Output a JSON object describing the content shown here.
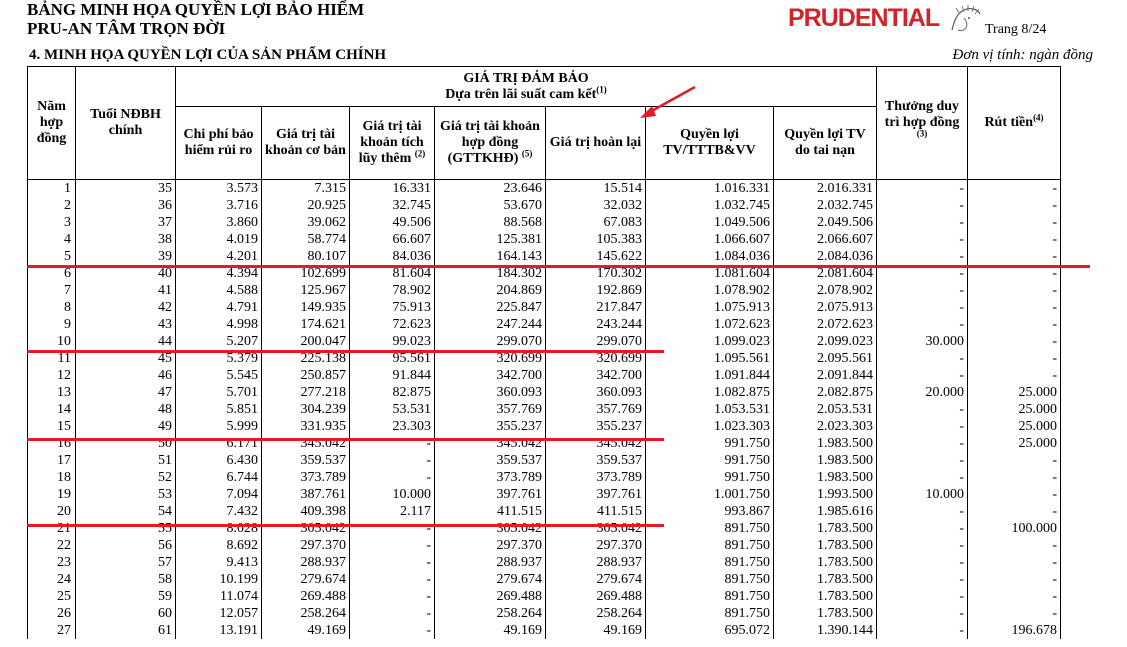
{
  "header": {
    "title_line1": "BẢNG MINH HỌA QUYỀN LỢI BẢO HIỂM",
    "title_line2": "PRU-AN TÂM TRỌN ĐỜI",
    "logo": "PRUDENTIAL",
    "page": "Trang 8/24",
    "section": "4. MINH HỌA QUYỀN LỢI CỦA SẢN PHẨM CHÍNH",
    "unit": "Đơn vị tính: ngàn đồng"
  },
  "table": {
    "guaranteed_title": "GIÁ TRỊ ĐẢM BẢO",
    "guaranteed_subtitle": "Dựa trên lãi suất cam kết",
    "guaranteed_subtitle_sup": "(1)",
    "col_year": "Năm hợp đồng",
    "col_age": "Tuổi NĐBH chính",
    "col_risk_cost": "Chi phí bảo hiểm rủi ro",
    "col_base_account": "Giá trị tài khoản cơ bản",
    "col_extra_account": "Giá trị tài khoản tích lũy thêm",
    "col_extra_account_sup": "(2)",
    "col_contract_account": "Giá trị tài khoản hợp đồng (GTTKHĐ)",
    "col_contract_account_sup": "(5)",
    "col_surrender": "Giá trị hoàn lại",
    "col_death_tpd": "Quyền lợi TV/TTTB&VV",
    "col_accident": "Quyền lợi TV do tai nạn",
    "col_bonus": "Thưởng duy trì hợp đồng",
    "col_bonus_sup": "(3)",
    "col_withdraw": "Rút tiền",
    "col_withdraw_sup": "(4)",
    "rows": [
      [
        "1",
        "35",
        "3.573",
        "7.315",
        "16.331",
        "23.646",
        "15.514",
        "1.016.331",
        "2.016.331",
        "-",
        "-"
      ],
      [
        "2",
        "36",
        "3.716",
        "20.925",
        "32.745",
        "53.670",
        "32.032",
        "1.032.745",
        "2.032.745",
        "-",
        "-"
      ],
      [
        "3",
        "37",
        "3.860",
        "39.062",
        "49.506",
        "88.568",
        "67.083",
        "1.049.506",
        "2.049.506",
        "-",
        "-"
      ],
      [
        "4",
        "38",
        "4.019",
        "58.774",
        "66.607",
        "125.381",
        "105.383",
        "1.066.607",
        "2.066.607",
        "-",
        "-"
      ],
      [
        "5",
        "39",
        "4.201",
        "80.107",
        "84.036",
        "164.143",
        "145.622",
        "1.084.036",
        "2.084.036",
        "-",
        "-"
      ],
      [
        "6",
        "40",
        "4.394",
        "102.699",
        "81.604",
        "184.302",
        "170.302",
        "1.081.604",
        "2.081.604",
        "-",
        "-"
      ],
      [
        "7",
        "41",
        "4.588",
        "125.967",
        "78.902",
        "204.869",
        "192.869",
        "1.078.902",
        "2.078.902",
        "-",
        "-"
      ],
      [
        "8",
        "42",
        "4.791",
        "149.935",
        "75.913",
        "225.847",
        "217.847",
        "1.075.913",
        "2.075.913",
        "-",
        "-"
      ],
      [
        "9",
        "43",
        "4.998",
        "174.621",
        "72.623",
        "247.244",
        "243.244",
        "1.072.623",
        "2.072.623",
        "-",
        "-"
      ],
      [
        "10",
        "44",
        "5.207",
        "200.047",
        "99.023",
        "299.070",
        "299.070",
        "1.099.023",
        "2.099.023",
        "30.000",
        "-"
      ],
      [
        "11",
        "45",
        "5.379",
        "225.138",
        "95.561",
        "320.699",
        "320.699",
        "1.095.561",
        "2.095.561",
        "-",
        "-"
      ],
      [
        "12",
        "46",
        "5.545",
        "250.857",
        "91.844",
        "342.700",
        "342.700",
        "1.091.844",
        "2.091.844",
        "-",
        "-"
      ],
      [
        "13",
        "47",
        "5.701",
        "277.218",
        "82.875",
        "360.093",
        "360.093",
        "1.082.875",
        "2.082.875",
        "20.000",
        "25.000"
      ],
      [
        "14",
        "48",
        "5.851",
        "304.239",
        "53.531",
        "357.769",
        "357.769",
        "1.053.531",
        "2.053.531",
        "-",
        "25.000"
      ],
      [
        "15",
        "49",
        "5.999",
        "331.935",
        "23.303",
        "355.237",
        "355.237",
        "1.023.303",
        "2.023.303",
        "-",
        "25.000"
      ],
      [
        "16",
        "50",
        "6.171",
        "345.042",
        "-",
        "345.042",
        "345.042",
        "991.750",
        "1.983.500",
        "-",
        "25.000"
      ],
      [
        "17",
        "51",
        "6.430",
        "359.537",
        "-",
        "359.537",
        "359.537",
        "991.750",
        "1.983.500",
        "-",
        "-"
      ],
      [
        "18",
        "52",
        "6.744",
        "373.789",
        "-",
        "373.789",
        "373.789",
        "991.750",
        "1.983.500",
        "-",
        "-"
      ],
      [
        "19",
        "53",
        "7.094",
        "387.761",
        "10.000",
        "397.761",
        "397.761",
        "1.001.750",
        "1.993.500",
        "10.000",
        "-"
      ],
      [
        "20",
        "54",
        "7.432",
        "409.398",
        "2.117",
        "411.515",
        "411.515",
        "993.867",
        "1.985.616",
        "-",
        "-"
      ],
      [
        "21",
        "55",
        "8.028",
        "305.042",
        "-",
        "305.042",
        "305.042",
        "891.750",
        "1.783.500",
        "-",
        "100.000"
      ],
      [
        "22",
        "56",
        "8.692",
        "297.370",
        "-",
        "297.370",
        "297.370",
        "891.750",
        "1.783.500",
        "-",
        "-"
      ],
      [
        "23",
        "57",
        "9.413",
        "288.937",
        "-",
        "288.937",
        "288.937",
        "891.750",
        "1.783.500",
        "-",
        "-"
      ],
      [
        "24",
        "58",
        "10.199",
        "279.674",
        "-",
        "279.674",
        "279.674",
        "891.750",
        "1.783.500",
        "-",
        "-"
      ],
      [
        "25",
        "59",
        "11.074",
        "269.488",
        "-",
        "269.488",
        "269.488",
        "891.750",
        "1.783.500",
        "-",
        "-"
      ],
      [
        "26",
        "60",
        "12.057",
        "258.264",
        "-",
        "258.264",
        "258.264",
        "891.750",
        "1.783.500",
        "-",
        "-"
      ],
      [
        "27",
        "61",
        "13.191",
        "49.169",
        "-",
        "49.169",
        "49.169",
        "695.072",
        "1.390.144",
        "-",
        "196.678"
      ]
    ]
  },
  "annotation_color": "#e31b23",
  "logo_color": "#d3232a"
}
